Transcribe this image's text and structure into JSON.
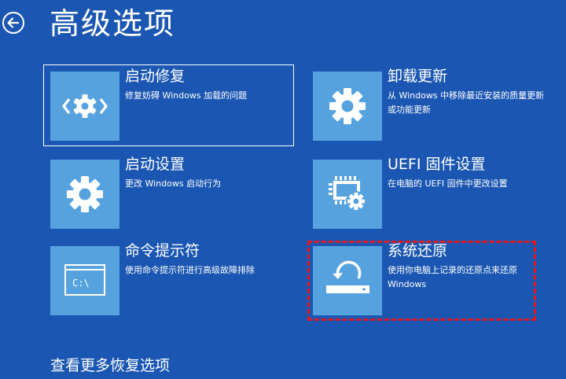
{
  "page": {
    "title": "高级选项",
    "back_icon": "back-arrow-icon",
    "background_color": "#1b57b2",
    "tile_color": "#56a2df",
    "highlight_color": "#e8161d"
  },
  "options": [
    {
      "id": "startup-repair",
      "title": "启动修复",
      "desc": "修复妨碍 Windows 加载的问题",
      "icon": "code-gear-icon"
    },
    {
      "id": "uninstall-updates",
      "title": "卸载更新",
      "desc": "从 Windows 中移除最近安装的质量更新或功能更新",
      "icon": "gear-icon"
    },
    {
      "id": "startup-settings",
      "title": "启动设置",
      "desc": "更改 Windows 启动行为",
      "icon": "gear-icon"
    },
    {
      "id": "uefi-firmware-settings",
      "title": "UEFI 固件设置",
      "desc": "在电脑的 UEFI 固件中更改设置",
      "icon": "chip-gear-icon"
    },
    {
      "id": "command-prompt",
      "title": "命令提示符",
      "desc": "使用命令提示符进行高级故障排除",
      "icon": "command-prompt-icon"
    },
    {
      "id": "system-restore",
      "title": "系统还原",
      "desc": "使用你电脑上记录的还原点来还原 Windows",
      "icon": "system-restore-icon"
    }
  ],
  "cmd_icon_text": "C:\\",
  "more_link": "查看更多恢复选项"
}
